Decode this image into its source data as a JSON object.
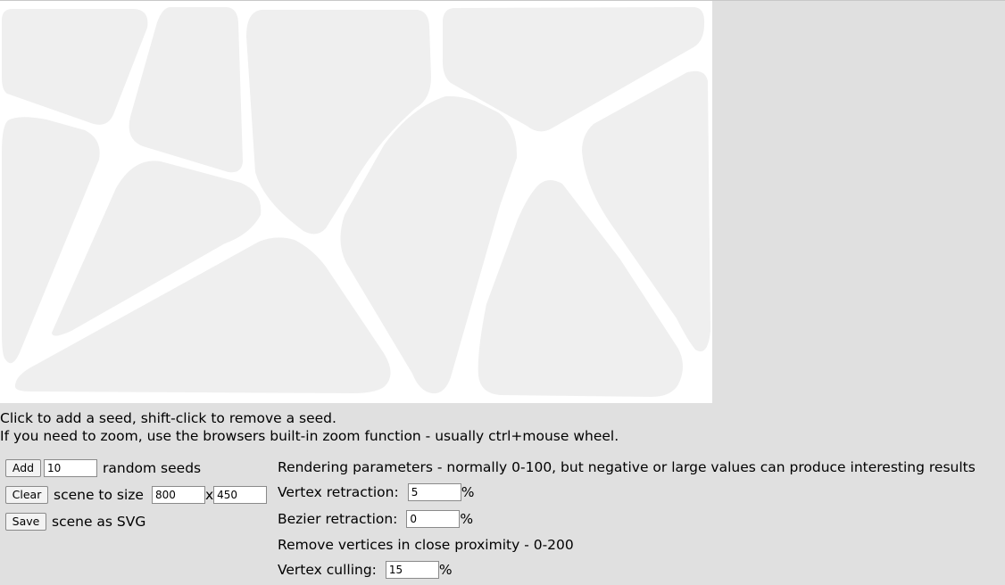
{
  "canvas": {
    "scene_width": 800,
    "scene_height": 450
  },
  "instructions": {
    "line1": "Click to add a seed, shift-click to remove a seed.",
    "line2": "If you need to zoom, use the browsers built-in zoom function - usually ctrl+mouse wheel."
  },
  "controls": {
    "add": {
      "button": "Add",
      "value": "10",
      "suffix": "random seeds"
    },
    "clear": {
      "button": "Clear",
      "label": "scene to size",
      "width": "800",
      "separator": "x",
      "height": "450"
    },
    "save": {
      "button": "Save",
      "label": "scene as SVG"
    }
  },
  "rendering": {
    "heading": "Rendering parameters - normally 0-100, but negative or large values can produce interesting results",
    "vertex_retraction": {
      "label": "Vertex retraction:",
      "value": "5",
      "unit": "%"
    },
    "bezier_retraction": {
      "label": "Bezier retraction:",
      "value": "0",
      "unit": "%"
    },
    "proximity_heading": "Remove vertices in close proximity - 0-200",
    "vertex_culling": {
      "label": "Vertex culling:",
      "value": "15",
      "unit": "%"
    }
  },
  "colors": {
    "page_background": "#e0e0e0",
    "canvas_background": "#ffffff",
    "cell_fill": "#efefef"
  }
}
